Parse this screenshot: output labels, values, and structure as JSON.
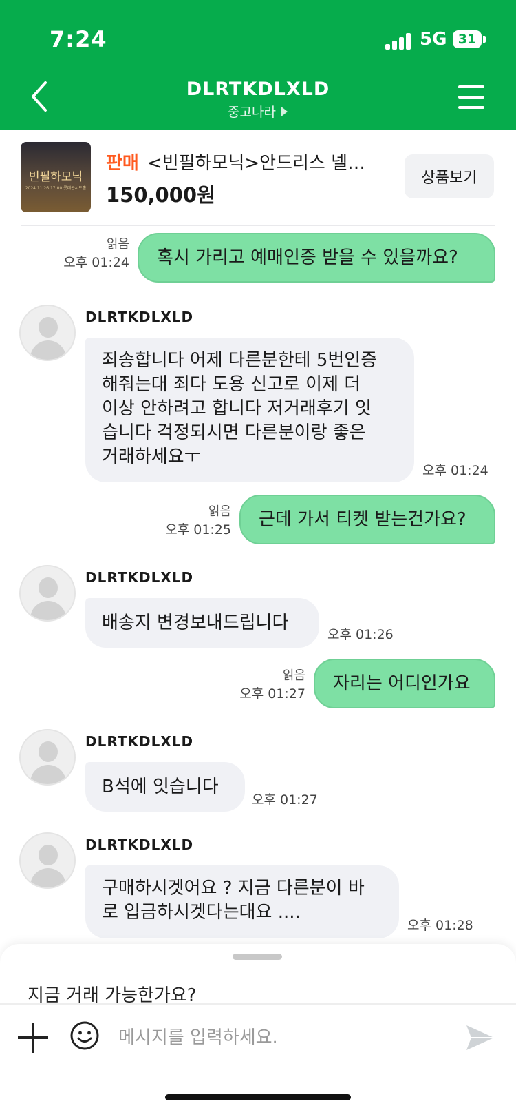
{
  "status_bar": {
    "time": "7:24",
    "network": "5G",
    "battery": "31"
  },
  "header": {
    "title": "DLRTKDLXLD",
    "subtitle": "중고나라",
    "back_icon": "chevron-left-icon",
    "menu_icon": "hamburger-menu-icon"
  },
  "product": {
    "type_label": "판매",
    "name": "<빈필하모닉>안드리스 넬…",
    "price": "150,000원",
    "view_button": "상품보기",
    "thumbnail_title": "빈필하모닉",
    "thumbnail_text": "2024 11.26 17:00 롯데콘서트홀"
  },
  "messages": [
    {
      "from": "me",
      "text": "혹시 가리고 예매인증 받을 수 있을까요?",
      "read": "읽음",
      "time": "오후 01:24"
    },
    {
      "from": "other",
      "sender": "DLRTKDLXLD",
      "lines": [
        "죄송합니다 어제 다른분한테 5번인증",
        "해줘는대 죄다 도용 신고로 이제 더",
        "이상 안하려고 합니다 저거래후기 잇",
        "습니다 걱정되시면 다른분이랑 좋은",
        "거래하세요ㅜ"
      ],
      "time": "오후 01:24"
    },
    {
      "from": "me",
      "text": "근데 가서 티켓 받는건가요?",
      "read": "읽음",
      "time": "오후 01:25"
    },
    {
      "from": "other",
      "sender": "DLRTKDLXLD",
      "lines": [
        "배송지 변경보내드립니다"
      ],
      "time": "오후 01:26"
    },
    {
      "from": "me",
      "text": "자리는 어디인가요",
      "read": "읽음",
      "time": "오후 01:27"
    },
    {
      "from": "other",
      "sender": "DLRTKDLXLD",
      "lines": [
        "B석에 잇습니다"
      ],
      "time": "오후 01:27"
    },
    {
      "from": "other",
      "sender": "DLRTKDLXLD",
      "lines": [
        "구매하시겟어요 ? 지금 다른분이 바",
        "로 입금하시겟다는대요 ...."
      ],
      "time": "오후 01:28"
    }
  ],
  "composer": {
    "suggestion": "지금 거래 가능한가요?",
    "placeholder": "메시지를 입력하세요.",
    "plus_icon": "plus-icon",
    "emoji_icon": "emoji-icon",
    "send_icon": "send-icon"
  },
  "colors": {
    "brand": "#06ac4c",
    "my_bubble": "#7ee0a4",
    "their_bubble": "#f0f1f5",
    "accent_orange": "#ff5a1f"
  }
}
